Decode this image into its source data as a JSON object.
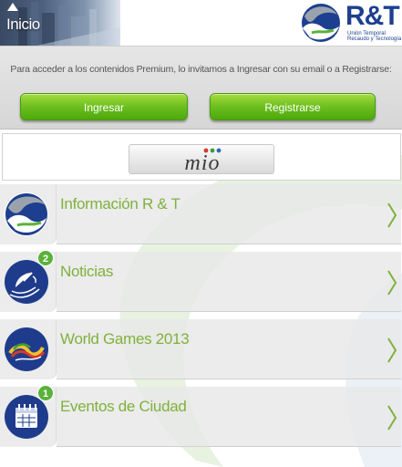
{
  "header": {
    "home_label": "Inicio",
    "brand_name": "R&T",
    "brand_sub1": "Unión Temporal",
    "brand_sub2": "Recaudo y Tecnología"
  },
  "login": {
    "message": "Para acceder a los contenidos Premium, lo invitamos a Ingresar con su email o a Registrarse:",
    "login_label": "Ingresar",
    "register_label": "Registrarse"
  },
  "sponsor": {
    "logo_text": "mio"
  },
  "menu": {
    "items": [
      {
        "label": "Información R & T",
        "icon": "rt-logo-icon",
        "badge": ""
      },
      {
        "label": "Noticias",
        "icon": "satellite-dish-icon",
        "badge": "2"
      },
      {
        "label": "World Games 2013",
        "icon": "world-games-icon",
        "badge": ""
      },
      {
        "label": "Eventos de Ciudad",
        "icon": "calendar-icon",
        "badge": "1"
      }
    ]
  },
  "colors": {
    "accent_green": "#7fb13c",
    "button_green": "#6cbf1e",
    "brand_blue": "#1d3f8f",
    "badge_green": "#5ab23a"
  }
}
